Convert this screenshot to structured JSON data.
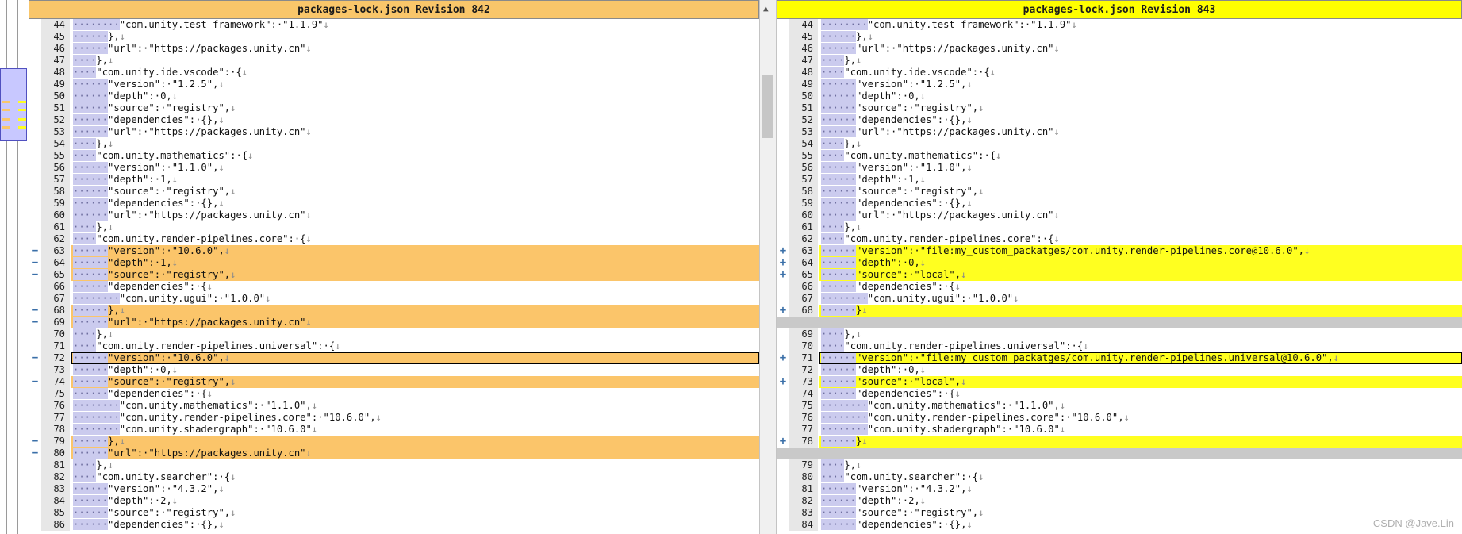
{
  "left_pane": {
    "title": "packages-lock.json Revision 842",
    "colors": {
      "title_bg": "#f9c66a",
      "change_bg": "#fbc56a",
      "removed_highlight": "#e06060"
    },
    "change_marker": "−",
    "lines": [
      {
        "no": "44",
        "ws": "········",
        "text": "\"com.unity.test-framework\":·\"1.1.9\"",
        "eol": "↓"
      },
      {
        "no": "45",
        "ws": "······",
        "text": "},",
        "eol": "↓"
      },
      {
        "no": "46",
        "ws": "······",
        "text": "\"url\":·\"https://packages.unity.cn\"",
        "eol": "↓"
      },
      {
        "no": "47",
        "ws": "····",
        "text": "},",
        "eol": "↓"
      },
      {
        "no": "48",
        "ws": "····",
        "text": "\"com.unity.ide.vscode\":·{",
        "eol": "↓"
      },
      {
        "no": "49",
        "ws": "······",
        "text": "\"version\":·\"1.2.5\",",
        "eol": "↓"
      },
      {
        "no": "50",
        "ws": "······",
        "text": "\"depth\":·0,",
        "eol": "↓"
      },
      {
        "no": "51",
        "ws": "······",
        "text": "\"source\":·\"registry\",",
        "eol": "↓"
      },
      {
        "no": "52",
        "ws": "······",
        "text": "\"dependencies\":·{},",
        "eol": "↓"
      },
      {
        "no": "53",
        "ws": "······",
        "text": "\"url\":·\"https://packages.unity.cn\"",
        "eol": "↓"
      },
      {
        "no": "54",
        "ws": "····",
        "text": "},",
        "eol": "↓"
      },
      {
        "no": "55",
        "ws": "····",
        "text": "\"com.unity.mathematics\":·{",
        "eol": "↓"
      },
      {
        "no": "56",
        "ws": "······",
        "text": "\"version\":·\"1.1.0\",",
        "eol": "↓"
      },
      {
        "no": "57",
        "ws": "······",
        "text": "\"depth\":·1,",
        "eol": "↓"
      },
      {
        "no": "58",
        "ws": "······",
        "text": "\"source\":·\"registry\",",
        "eol": "↓"
      },
      {
        "no": "59",
        "ws": "······",
        "text": "\"dependencies\":·{},",
        "eol": "↓"
      },
      {
        "no": "60",
        "ws": "······",
        "text": "\"url\":·\"https://packages.unity.cn\"",
        "eol": "↓"
      },
      {
        "no": "61",
        "ws": "····",
        "text": "},",
        "eol": "↓"
      },
      {
        "no": "62",
        "ws": "····",
        "text": "\"com.unity.render-pipelines.core\":·{",
        "eol": "↓"
      },
      {
        "no": "63",
        "ws": "······",
        "text": "\"version\":·\"10.6.0\",",
        "eol": "↓",
        "changed": true
      },
      {
        "no": "64",
        "ws": "······",
        "text": "\"depth\":·1,",
        "eol": "↓",
        "changed": true
      },
      {
        "no": "65",
        "ws": "······",
        "text": "\"source\":·\"registry\",",
        "eol": "↓",
        "changed": true
      },
      {
        "no": "66",
        "ws": "······",
        "text": "\"dependencies\":·{",
        "eol": "↓"
      },
      {
        "no": "67",
        "ws": "········",
        "text": "\"com.unity.ugui\":·\"1.0.0\"",
        "eol": "↓"
      },
      {
        "no": "68",
        "ws": "······",
        "text": "},",
        "eol": "↓",
        "changed": true
      },
      {
        "no": "69",
        "ws": "······",
        "text": "\"url\":·\"https://packages.unity.cn\"",
        "eol": "↓",
        "changed": true
      },
      {
        "no": "70",
        "ws": "····",
        "text": "},",
        "eol": "↓"
      },
      {
        "no": "71",
        "ws": "····",
        "text": "\"com.unity.render-pipelines.universal\":·{",
        "eol": "↓"
      },
      {
        "no": "72",
        "ws": "······",
        "text": "\"version\":·\"10.6.0\",",
        "eol": "↓",
        "changed": true,
        "current": true
      },
      {
        "no": "73",
        "ws": "······",
        "text": "\"depth\":·0,",
        "eol": "↓"
      },
      {
        "no": "74",
        "ws": "······",
        "text": "\"source\":·\"registry\",",
        "eol": "↓",
        "changed": true
      },
      {
        "no": "75",
        "ws": "······",
        "text": "\"dependencies\":·{",
        "eol": "↓"
      },
      {
        "no": "76",
        "ws": "········",
        "text": "\"com.unity.mathematics\":·\"1.1.0\",",
        "eol": "↓"
      },
      {
        "no": "77",
        "ws": "········",
        "text": "\"com.unity.render-pipelines.core\":·\"10.6.0\",",
        "eol": "↓"
      },
      {
        "no": "78",
        "ws": "········",
        "text": "\"com.unity.shadergraph\":·\"10.6.0\"",
        "eol": "↓"
      },
      {
        "no": "79",
        "ws": "······",
        "text": "},",
        "eol": "↓",
        "changed": true
      },
      {
        "no": "80",
        "ws": "······",
        "text": "\"url\":·\"https://packages.unity.cn\"",
        "eol": "↓",
        "changed": true
      },
      {
        "no": "81",
        "ws": "····",
        "text": "},",
        "eol": "↓"
      },
      {
        "no": "82",
        "ws": "····",
        "text": "\"com.unity.searcher\":·{",
        "eol": "↓"
      },
      {
        "no": "83",
        "ws": "······",
        "text": "\"version\":·\"4.3.2\",",
        "eol": "↓"
      },
      {
        "no": "84",
        "ws": "······",
        "text": "\"depth\":·2,",
        "eol": "↓"
      },
      {
        "no": "85",
        "ws": "······",
        "text": "\"source\":·\"registry\",",
        "eol": "↓"
      },
      {
        "no": "86",
        "ws": "······",
        "text": "\"dependencies\":·{},",
        "eol": "↓"
      }
    ]
  },
  "right_pane": {
    "title": "packages-lock.json Revision 843",
    "colors": {
      "title_bg": "#ffff00",
      "change_bg": "#ffff20",
      "empty_bg": "#c9c9c9"
    },
    "change_marker": "+",
    "lines": [
      {
        "no": "44",
        "ws": "········",
        "text": "\"com.unity.test-framework\":·\"1.1.9\"",
        "eol": "↓"
      },
      {
        "no": "45",
        "ws": "······",
        "text": "},",
        "eol": "↓"
      },
      {
        "no": "46",
        "ws": "······",
        "text": "\"url\":·\"https://packages.unity.cn\"",
        "eol": "↓"
      },
      {
        "no": "47",
        "ws": "····",
        "text": "},",
        "eol": "↓"
      },
      {
        "no": "48",
        "ws": "····",
        "text": "\"com.unity.ide.vscode\":·{",
        "eol": "↓"
      },
      {
        "no": "49",
        "ws": "······",
        "text": "\"version\":·\"1.2.5\",",
        "eol": "↓"
      },
      {
        "no": "50",
        "ws": "······",
        "text": "\"depth\":·0,",
        "eol": "↓"
      },
      {
        "no": "51",
        "ws": "······",
        "text": "\"source\":·\"registry\",",
        "eol": "↓"
      },
      {
        "no": "52",
        "ws": "······",
        "text": "\"dependencies\":·{},",
        "eol": "↓"
      },
      {
        "no": "53",
        "ws": "······",
        "text": "\"url\":·\"https://packages.unity.cn\"",
        "eol": "↓"
      },
      {
        "no": "54",
        "ws": "····",
        "text": "},",
        "eol": "↓"
      },
      {
        "no": "55",
        "ws": "····",
        "text": "\"com.unity.mathematics\":·{",
        "eol": "↓"
      },
      {
        "no": "56",
        "ws": "······",
        "text": "\"version\":·\"1.1.0\",",
        "eol": "↓"
      },
      {
        "no": "57",
        "ws": "······",
        "text": "\"depth\":·1,",
        "eol": "↓"
      },
      {
        "no": "58",
        "ws": "······",
        "text": "\"source\":·\"registry\",",
        "eol": "↓"
      },
      {
        "no": "59",
        "ws": "······",
        "text": "\"dependencies\":·{},",
        "eol": "↓"
      },
      {
        "no": "60",
        "ws": "······",
        "text": "\"url\":·\"https://packages.unity.cn\"",
        "eol": "↓"
      },
      {
        "no": "61",
        "ws": "····",
        "text": "},",
        "eol": "↓"
      },
      {
        "no": "62",
        "ws": "····",
        "text": "\"com.unity.render-pipelines.core\":·{",
        "eol": "↓"
      },
      {
        "no": "63",
        "ws": "······",
        "text": "\"version\":·\"file:my_custom_packatges/com.unity.render-pipelines.core@10.6.0\",",
        "eol": "↓",
        "changed": true
      },
      {
        "no": "64",
        "ws": "······",
        "text": "\"depth\":·0,",
        "eol": "↓",
        "changed": true
      },
      {
        "no": "65",
        "ws": "······",
        "text": "\"source\":·\"local\",",
        "eol": "↓",
        "changed": true
      },
      {
        "no": "66",
        "ws": "······",
        "text": "\"dependencies\":·{",
        "eol": "↓"
      },
      {
        "no": "67",
        "ws": "········",
        "text": "\"com.unity.ugui\":·\"1.0.0\"",
        "eol": "↓"
      },
      {
        "no": "68",
        "ws": "······",
        "text": "}",
        "eol": "↓",
        "changed": true
      },
      {
        "no": "",
        "ws": "",
        "text": "",
        "eol": "",
        "empty": true
      },
      {
        "no": "69",
        "ws": "····",
        "text": "},",
        "eol": "↓"
      },
      {
        "no": "70",
        "ws": "····",
        "text": "\"com.unity.render-pipelines.universal\":·{",
        "eol": "↓"
      },
      {
        "no": "71",
        "ws": "······",
        "text": "\"version\":·\"file:my_custom_packatges/com.unity.render-pipelines.universal@10.6.0\",",
        "eol": "↓",
        "changed": true,
        "current": true
      },
      {
        "no": "72",
        "ws": "······",
        "text": "\"depth\":·0,",
        "eol": "↓"
      },
      {
        "no": "73",
        "ws": "······",
        "text": "\"source\":·\"local\",",
        "eol": "↓",
        "changed": true
      },
      {
        "no": "74",
        "ws": "······",
        "text": "\"dependencies\":·{",
        "eol": "↓"
      },
      {
        "no": "75",
        "ws": "········",
        "text": "\"com.unity.mathematics\":·\"1.1.0\",",
        "eol": "↓"
      },
      {
        "no": "76",
        "ws": "········",
        "text": "\"com.unity.render-pipelines.core\":·\"10.6.0\",",
        "eol": "↓"
      },
      {
        "no": "77",
        "ws": "········",
        "text": "\"com.unity.shadergraph\":·\"10.6.0\"",
        "eol": "↓"
      },
      {
        "no": "78",
        "ws": "······",
        "text": "}",
        "eol": "↓",
        "changed": true
      },
      {
        "no": "",
        "ws": "",
        "text": "",
        "eol": "",
        "empty": true
      },
      {
        "no": "79",
        "ws": "····",
        "text": "},",
        "eol": "↓"
      },
      {
        "no": "80",
        "ws": "····",
        "text": "\"com.unity.searcher\":·{",
        "eol": "↓"
      },
      {
        "no": "81",
        "ws": "······",
        "text": "\"version\":·\"4.3.2\",",
        "eol": "↓"
      },
      {
        "no": "82",
        "ws": "······",
        "text": "\"depth\":·2,",
        "eol": "↓"
      },
      {
        "no": "83",
        "ws": "······",
        "text": "\"source\":·\"registry\",",
        "eol": "↓"
      },
      {
        "no": "84",
        "ws": "······",
        "text": "\"dependencies\":·{},",
        "eol": "↓"
      }
    ]
  },
  "scroll_up_glyph": "▲",
  "watermark": "CSDN @Jave.Lin",
  "icons": {
    "scroll_up": "up-arrow-icon"
  }
}
